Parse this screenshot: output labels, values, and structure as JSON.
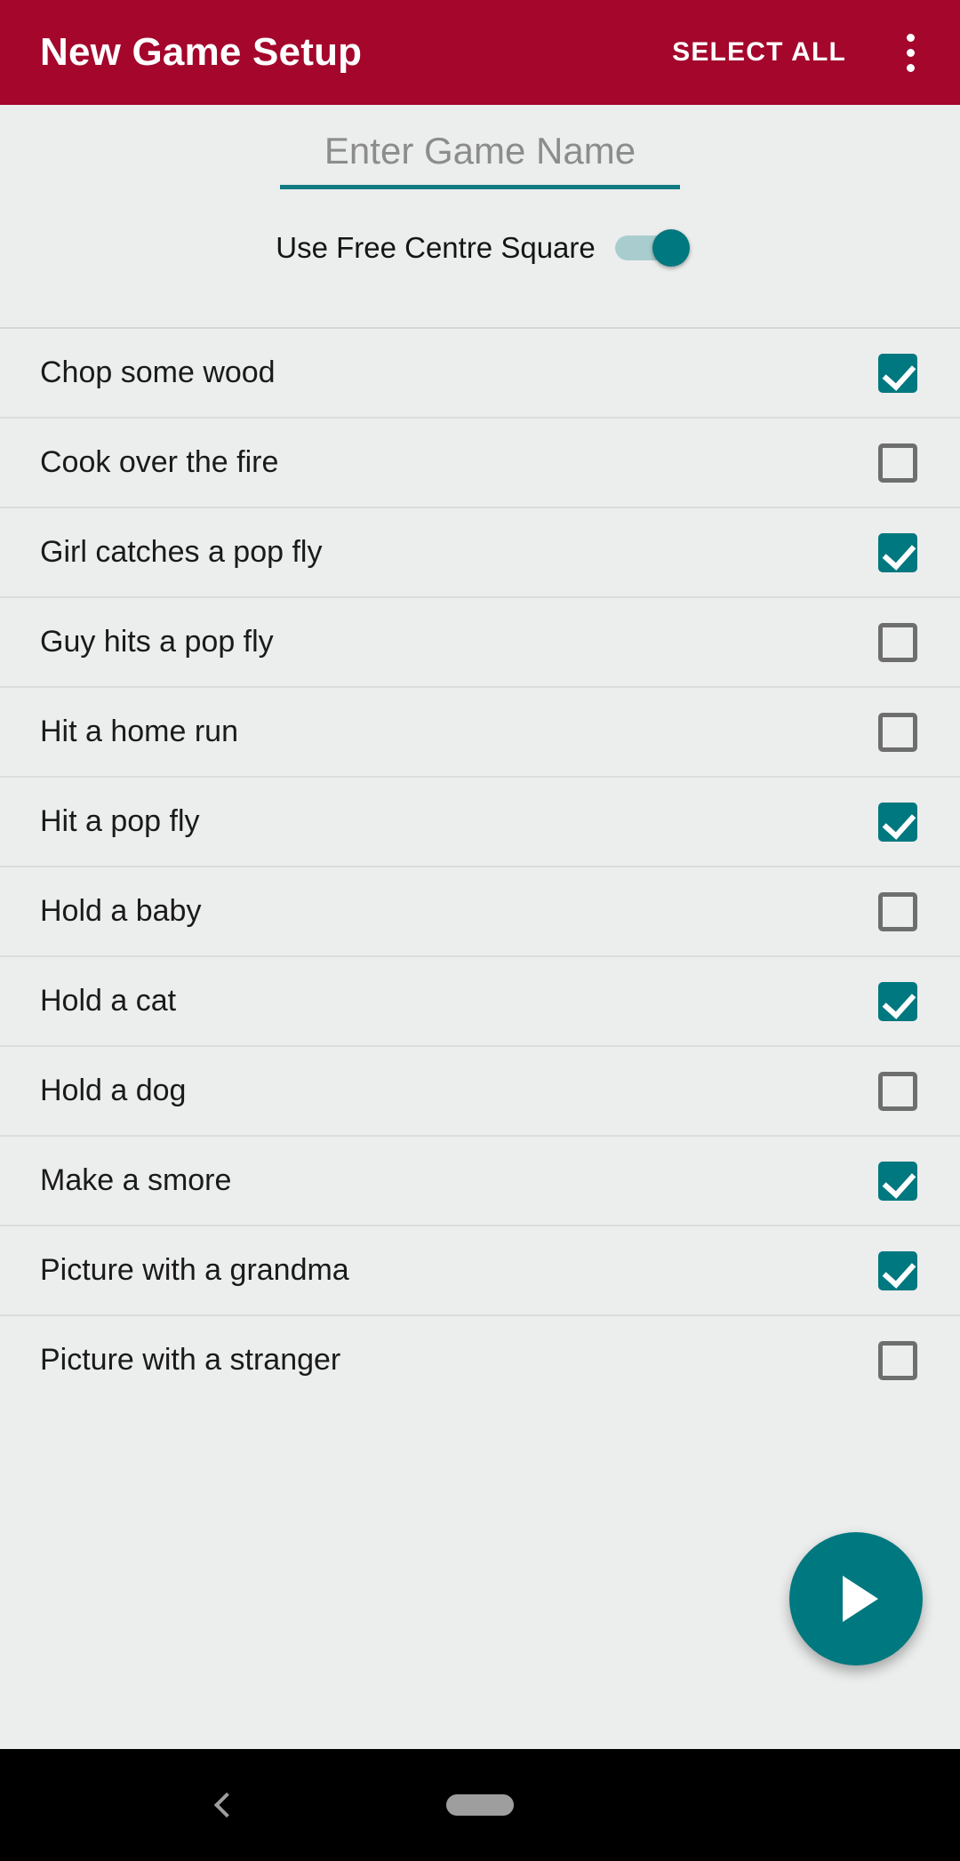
{
  "appbar": {
    "title": "New Game Setup",
    "action_label": "SELECT ALL",
    "overflow_icon": "more-vert-icon",
    "background_color": "#a4062c",
    "text_color": "#ffffff"
  },
  "form": {
    "game_name_value": "",
    "game_name_placeholder": "Enter Game Name",
    "underline_color": "#107b80",
    "free_centre_label": "Use Free Centre Square",
    "free_centre_state": "on"
  },
  "colors": {
    "accent_teal": "#00787f",
    "background": "#eceded",
    "divider": "#dcdcdc",
    "checkbox_off_border": "#6e6e6e"
  },
  "list": {
    "items": [
      {
        "label": "Chop some wood",
        "checked": true
      },
      {
        "label": "Cook over the fire",
        "checked": false
      },
      {
        "label": "Girl catches a pop fly",
        "checked": true
      },
      {
        "label": "Guy hits a pop fly",
        "checked": false
      },
      {
        "label": "Hit a home run",
        "checked": false
      },
      {
        "label": "Hit a pop fly",
        "checked": true
      },
      {
        "label": "Hold a baby",
        "checked": false
      },
      {
        "label": "Hold a cat",
        "checked": true
      },
      {
        "label": "Hold a dog",
        "checked": false
      },
      {
        "label": "Make a smore",
        "checked": true
      },
      {
        "label": "Picture with a grandma",
        "checked": true
      },
      {
        "label": "Picture with a stranger",
        "checked": false
      }
    ]
  },
  "fab": {
    "icon": "play-icon",
    "color": "#00787f"
  },
  "navbar": {
    "back_icon": "back-chevron-icon",
    "home_icon": "home-pill-icon"
  }
}
